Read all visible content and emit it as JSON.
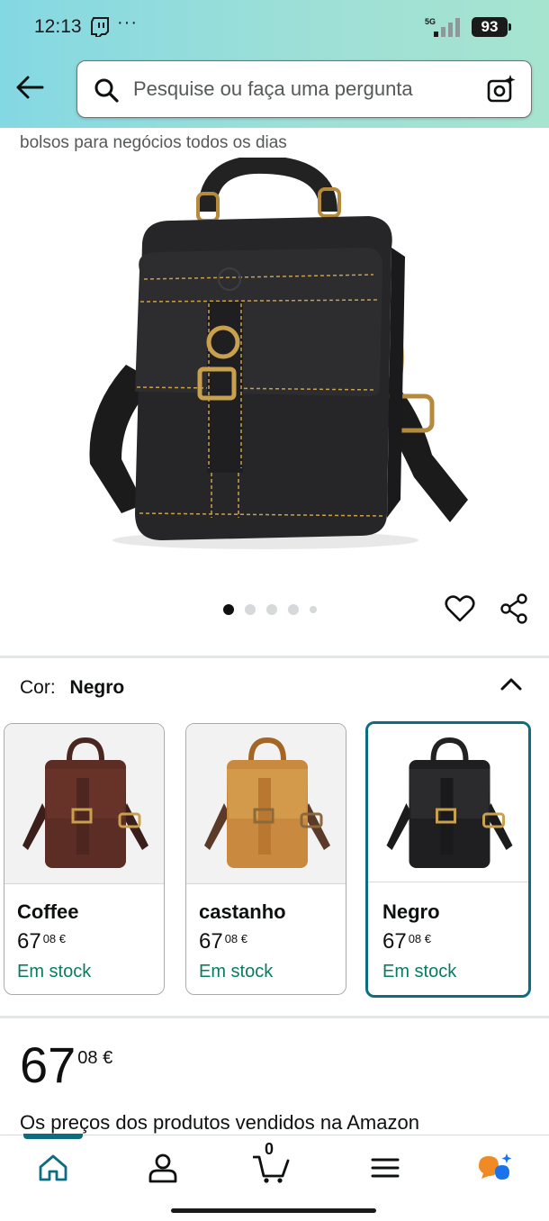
{
  "status_bar": {
    "time": "12:13",
    "more": "···",
    "network": "5G",
    "battery": "93"
  },
  "header": {
    "search_placeholder": "Pesquise ou faça uma pergunta"
  },
  "product": {
    "title_partial": "bolsos para negócios todos os dias",
    "image_count": 5,
    "active_image": 1
  },
  "variation": {
    "label": "Cor:",
    "selected": "Negro",
    "options": [
      {
        "name": "Coffee",
        "price_whole": "67",
        "price_fraction": "08 €",
        "stock": "Em stock",
        "color": "#5b2d25"
      },
      {
        "name": "castanho",
        "price_whole": "67",
        "price_fraction": "08 €",
        "stock": "Em stock",
        "color": "#c98a3f"
      },
      {
        "name": "Negro",
        "price_whole": "67",
        "price_fraction": "08 €",
        "stock": "Em stock",
        "color": "#1f1f21"
      }
    ]
  },
  "price": {
    "whole": "67",
    "fraction": "08 €",
    "notice": "Os preços dos produtos vendidos na Amazon"
  },
  "bottom_nav": {
    "cart_count": "0"
  },
  "colors": {
    "accent": "#0e6c81",
    "stock_green": "#067d62",
    "header_gradient_start": "#84d8e3",
    "header_gradient_end": "#a6e4d0"
  }
}
